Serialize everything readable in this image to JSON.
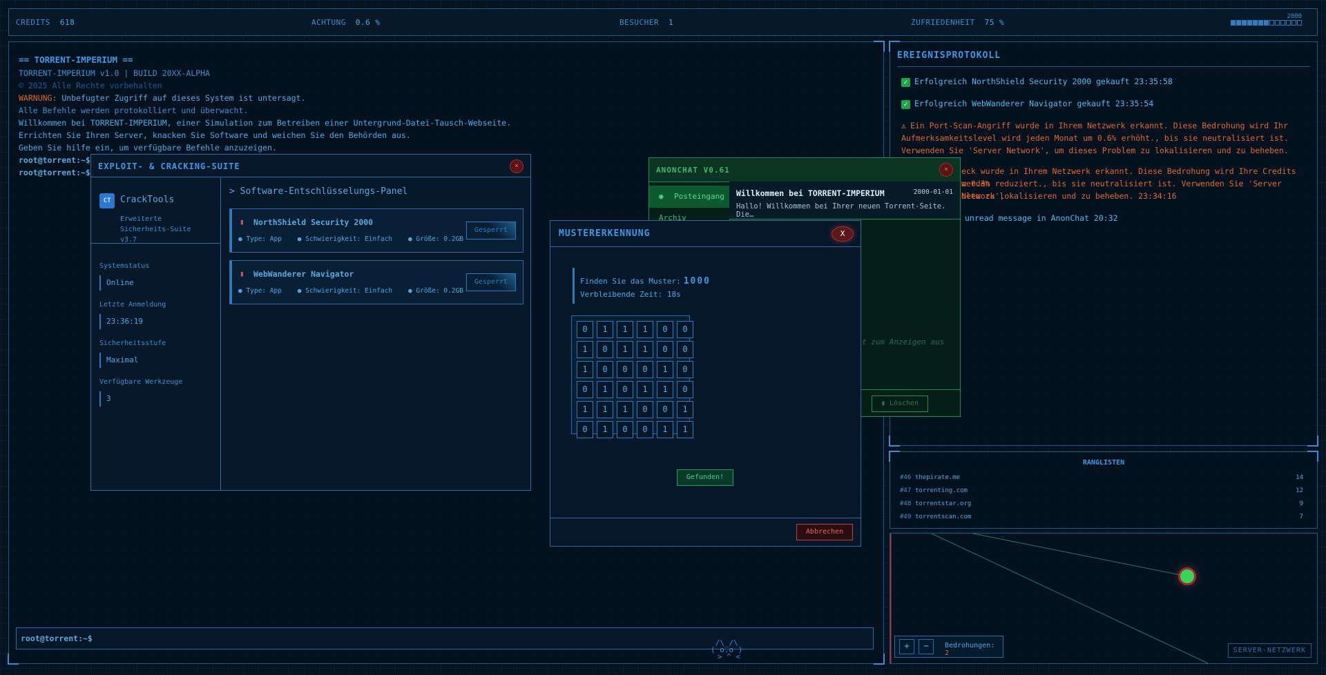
{
  "topbar": {
    "credits_label": "CREDITS",
    "credits_value": "618",
    "attention_label": "ACHTUNG",
    "attention_value": "0.6 %",
    "visitors_label": "BESUCHER",
    "visitors_value": "1",
    "satisfaction_label": "ZUFRIEDENHEIT",
    "satisfaction_value": "75 %",
    "year": "2000",
    "year_progress_fraction": 0.54
  },
  "terminal": {
    "lines": [
      "== TORRENT-IMPERIUM ==",
      "TORRENT-IMPERIUM v1.0 | BUILD 20XX-ALPHA",
      "© 2025 Alle Rechte vorbehalten",
      "Unbefugter Zugriff auf dieses System ist untersagt.",
      "Alle Befehle werden protokolliert und überwacht.",
      "Willkommen bei TORRENT-IMPERIUM, einer Simulation zum Betreiben einer Untergrund-Datei-Tausch-Webseite.",
      "Errichten Sie Ihren Server, knacken Sie Software und weichen Sie den Behörden aus.",
      "Geben Sie hilfe ein, um verfügbare Befehle anzuzeigen.",
      "root@torrent:~$",
      "root@torrent:~$"
    ],
    "warning_prefix": "WARNUNG:",
    "input_prompt": "root@torrent:~$"
  },
  "event_log": {
    "title": "EREIGNISPROTOKOLL",
    "events": [
      "Erfolgreich NorthShield Security 2000 gekauft 23:35:58",
      "Erfolgreich WebWanderer Navigator gekauft 23:35:54",
      "Ein Port-Scan-Angriff wurde in Ihrem Netzwerk erkannt. Diese Bedrohung wird Ihr Aufmerksamkeitslevel wird jeden Monat um 0.6% erhöht., bis sie neutralisiert ist. Verwenden Sie 'Server Network', um dieses Problem zu lokalisieren und zu beheben. 23:35:52",
      "eck wurde in Ihrem Netzwerk erkannt. Diese Bedrohung wird Ihre Credits werden",
      "m 0.3% reduziert., bis sie neutralisiert ist. Verwenden Sie 'Server Network',",
      "blem zu lokalisieren und zu beheben. 23:34:16",
      "unread message in AnonChat 20:32"
    ]
  },
  "ranklist": {
    "title": "RANGLISTEN",
    "rows": [
      {
        "pos": "#46",
        "name": "thepirate.me",
        "count": "14"
      },
      {
        "pos": "#47",
        "name": "torrenting.com",
        "count": "12"
      },
      {
        "pos": "#48",
        "name": "torrentstar.org",
        "count": "9"
      },
      {
        "pos": "#49",
        "name": "torrentscan.com",
        "count": "7"
      }
    ]
  },
  "network": {
    "plus": "+",
    "minus": "−",
    "threats_label": "Bedrohungen:",
    "threats_value": "2",
    "server_network_label": "SERVER-NETZWERK"
  },
  "exploit": {
    "title": "EXPLOIT- & CRACKING-SUITE",
    "close": "×",
    "logo_initials": "CT",
    "app_name": "CrackTools",
    "app_sub": "Erweiterte Sicherheits-Suite v3.7",
    "system_status_label": "Systemstatus",
    "system_status": "Online",
    "last_login_label": "Letzte Anmeldung",
    "last_login": "23:36:19",
    "security_level_label": "Sicherheitsstufe",
    "security_level": "Maximal",
    "tools_label": "Verfügbare Werkzeuge",
    "tools_value": "3",
    "panel_heading": "> Software-Entschlüsselungs-Panel",
    "software": [
      {
        "name": "NorthShield Security 2000",
        "meta": "● Type: App    ● Schwierigkeit: Einfach    ● Größe: 0.2GB",
        "button": "Gesperrt"
      },
      {
        "name": "WebWanderer Navigator",
        "meta": "● Type: App    ● Schwierigkeit: Einfach    ● Größe: 0.2GB",
        "button": "Gesperrt"
      }
    ]
  },
  "anonchat": {
    "title": "ANONCHAT V0.61",
    "close": "×",
    "tab_inbox": "Posteingang",
    "tab_archive": "Archiv",
    "message_subject": "Willkommen bei TORRENT-IMPERIUM",
    "message_date": "2000-01-01",
    "message_preview": "Hallo! Willkommen bei Ihrer neuen Torrent-Seite. Die…",
    "placeholder": "t zum Anzeigen aus",
    "delete_button": "Löschen"
  },
  "pattern": {
    "title": "MUSTERERKENNUNG",
    "close": "X",
    "find_label": "Finden Sie das Muster:",
    "pattern": "1000",
    "time_label": "Verbleibende Zeit: 18s",
    "grid": [
      [
        "0",
        "1",
        "1",
        "1",
        "0",
        "0"
      ],
      [
        "1",
        "0",
        "1",
        "1",
        "0",
        "0"
      ],
      [
        "1",
        "0",
        "0",
        "0",
        "1",
        "0"
      ],
      [
        "0",
        "1",
        "0",
        "1",
        "1",
        "0"
      ],
      [
        "1",
        "1",
        "1",
        "0",
        "0",
        "1"
      ],
      [
        "0",
        "1",
        "0",
        "0",
        "1",
        "1"
      ]
    ],
    "found_button": "Gefunden!",
    "cancel_button": "Abbrechen"
  }
}
